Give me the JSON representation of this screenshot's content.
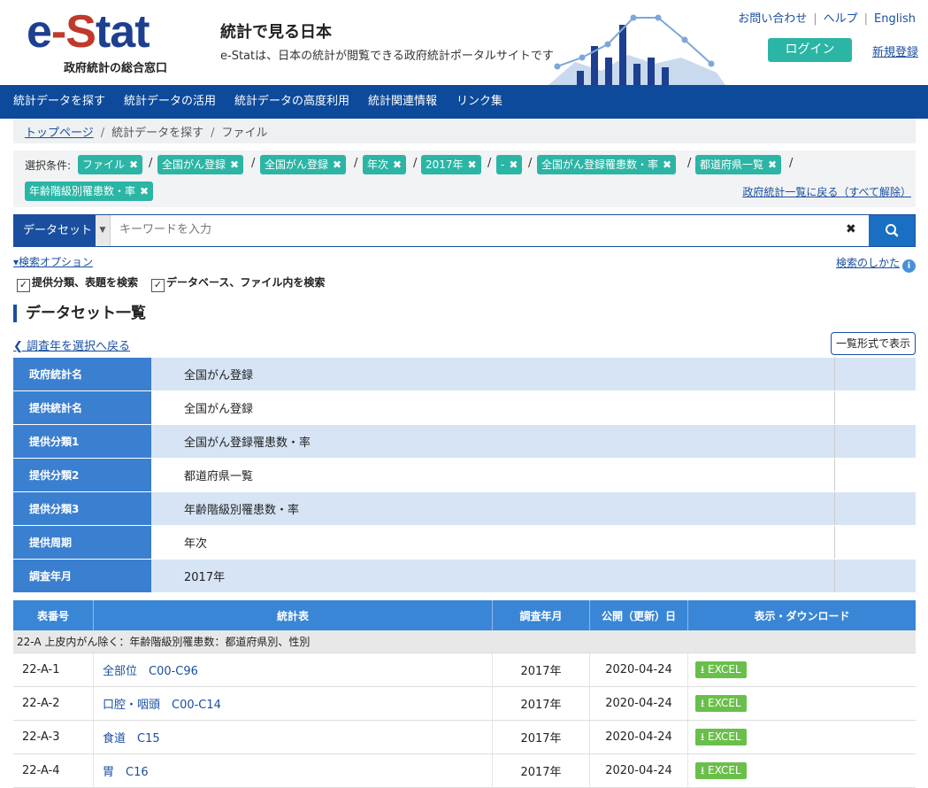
{
  "header": {
    "logo_text": "e-Stat",
    "logo_sub": "政府統計の総合窓口",
    "site_title": "統計で見る日本",
    "site_desc": "e-Statは、日本の統計が閲覧できる政府統計ポータルサイトです",
    "links": [
      "お問い合わせ",
      "ヘルプ",
      "English"
    ],
    "login": "ログイン",
    "signup": "新規登録"
  },
  "nav": [
    "統計データを探す",
    "統計データの活用",
    "統計データの高度利用",
    "統計関連情報",
    "リンク集"
  ],
  "breadcrumb": {
    "home": "トップページ",
    "search": "統計データを探す",
    "current": "ファイル"
  },
  "conditions": {
    "label": "選択条件:",
    "tags": [
      "ファイル",
      "全国がん登録",
      "全国がん登録",
      "年次",
      "2017年",
      "-",
      "全国がん登録罹患数・率",
      "都道府県一覧",
      "年齢階級別罹患数・率"
    ],
    "reset": "政府統計一覧に戻る（すべて解除）"
  },
  "search": {
    "scope": "データセット",
    "placeholder": "キーワードを入力",
    "options_link": "検索オプション",
    "howto": "検索のしかた",
    "checkbox1": "提供分類、表題を検索",
    "checkbox2": "データベース、ファイル内を検索"
  },
  "section": {
    "title": "データセット一覧",
    "back": "調査年を選択へ戻る",
    "list_view": "一覧形式で表示"
  },
  "info": [
    {
      "key": "政府統計名",
      "value": "全国がん登録"
    },
    {
      "key": "提供統計名",
      "value": "全国がん登録"
    },
    {
      "key": "提供分類1",
      "value": "全国がん登録罹患数・率"
    },
    {
      "key": "提供分類2",
      "value": "都道府県一覧"
    },
    {
      "key": "提供分類3",
      "value": "年齢階級別罹患数・率"
    },
    {
      "key": "提供周期",
      "value": "年次"
    },
    {
      "key": "調査年月",
      "value": "2017年"
    }
  ],
  "files": {
    "headers": [
      "表番号",
      "統計表",
      "調査年月",
      "公開（更新）日",
      "表示・ダウンロード"
    ],
    "group": "22-A 上皮内がん除く：年齢階級別罹患数：都道府県別、性別",
    "rows": [
      {
        "id": "22-A-1",
        "name": "全部位　C00-C96",
        "date": "2017年",
        "published": "2020-04-24",
        "download": "EXCEL"
      },
      {
        "id": "22-A-2",
        "name": "口腔・咽頭　C00-C14",
        "date": "2017年",
        "published": "2020-04-24",
        "download": "EXCEL"
      },
      {
        "id": "22-A-3",
        "name": "食道　C15",
        "date": "2017年",
        "published": "2020-04-24",
        "download": "EXCEL"
      },
      {
        "id": "22-A-4",
        "name": "胃　C16",
        "date": "2017年",
        "published": "2020-04-24",
        "download": "EXCEL"
      }
    ]
  },
  "colors": {
    "nav": "#0d4a9c",
    "teal": "#2bb5a5",
    "table_header": "#3a86d6",
    "excel": "#6abf4b"
  }
}
